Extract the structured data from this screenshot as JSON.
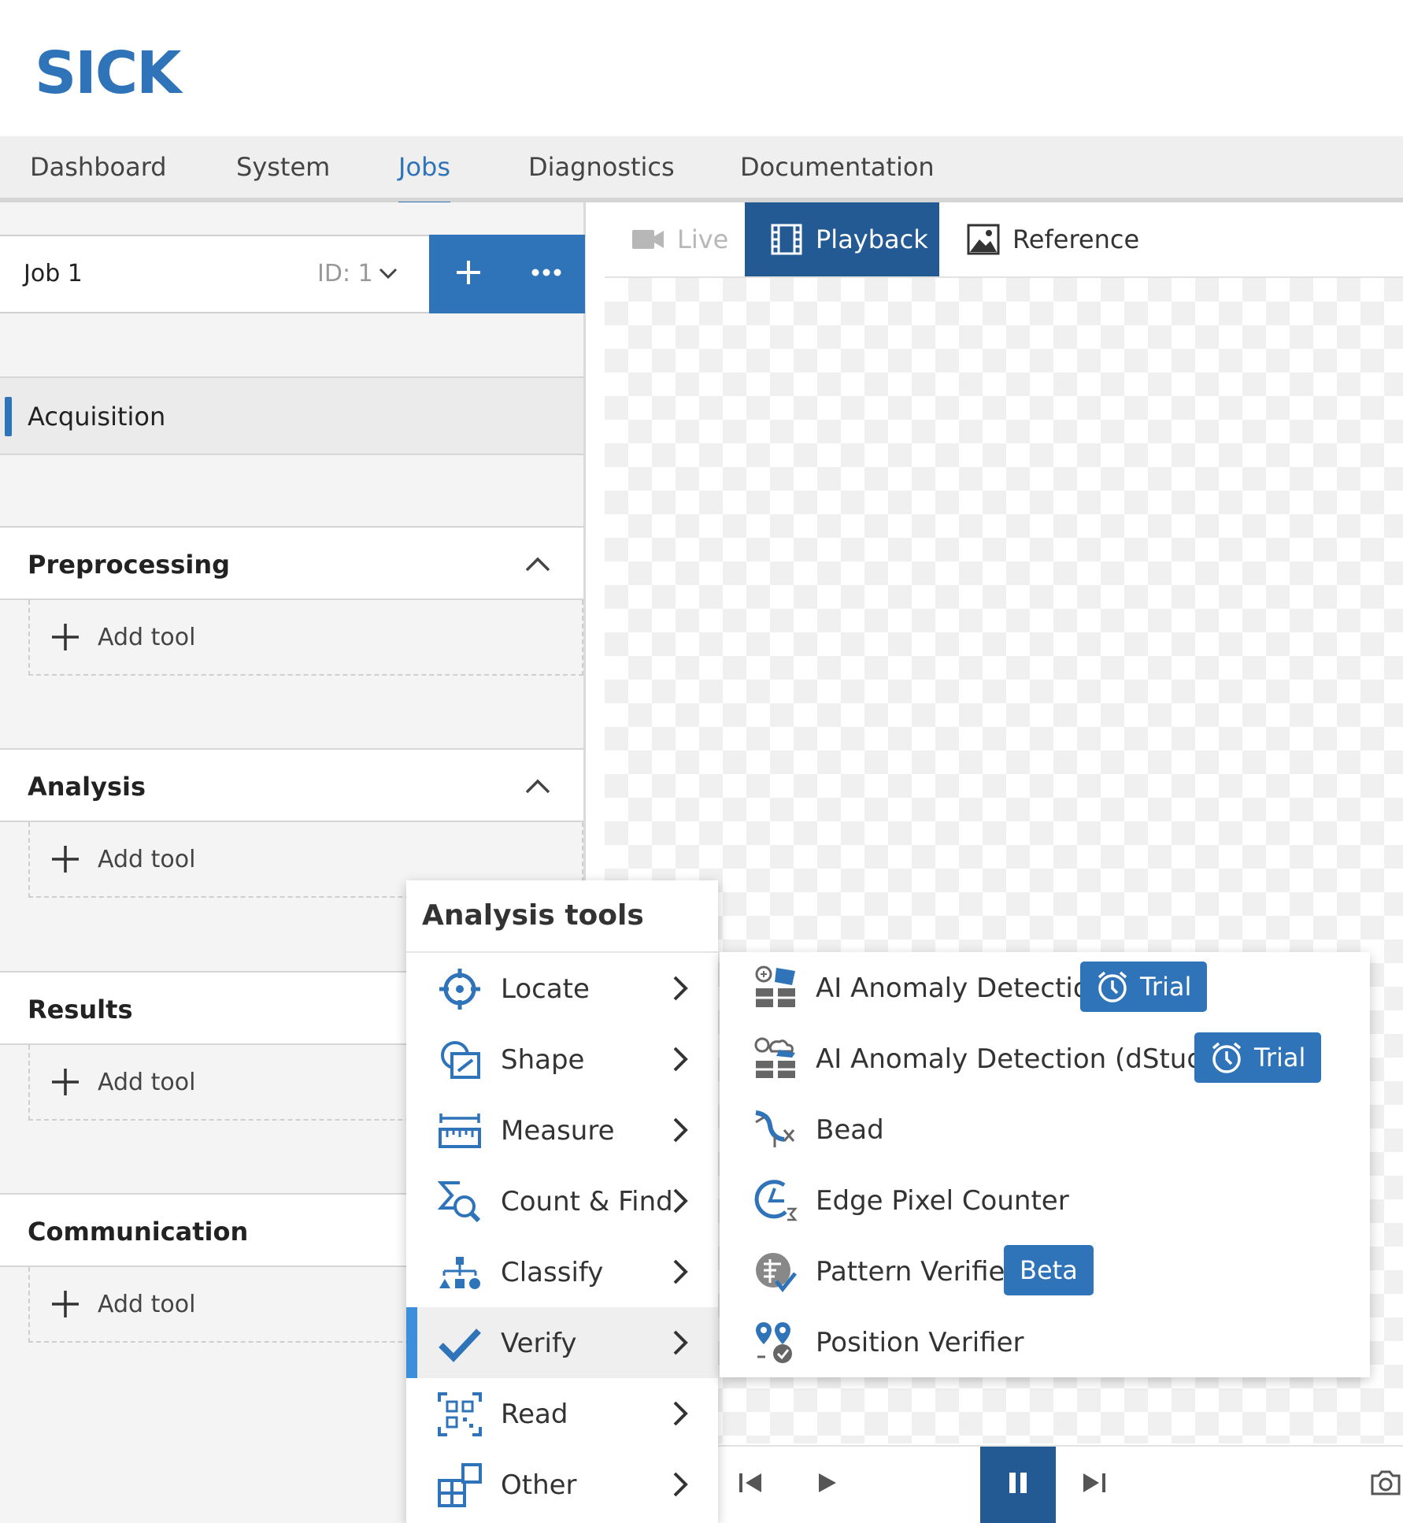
{
  "brand": {
    "logo_text": "SICK",
    "accent": "#2f73b8",
    "accent_dark": "#235a93",
    "highlight": "#3d8fdc"
  },
  "topnav": {
    "tabs": [
      {
        "label": "Dashboard"
      },
      {
        "label": "System"
      },
      {
        "label": "Jobs",
        "active": true
      },
      {
        "label": "Diagnostics"
      },
      {
        "label": "Documentation"
      }
    ]
  },
  "job": {
    "name": "Job 1",
    "id_label": "ID: 1"
  },
  "sidebar": {
    "acquisition": "Acquisition",
    "sections": [
      {
        "label": "Preprocessing",
        "add_label": "Add tool"
      },
      {
        "label": "Analysis",
        "add_label": "Add tool"
      },
      {
        "label": "Results",
        "add_label": "Add tool"
      },
      {
        "label": "Communication",
        "add_label": "Add tool"
      }
    ]
  },
  "viewer": {
    "tabs": [
      {
        "label": "Live",
        "icon": "video-camera-icon",
        "state": "disabled"
      },
      {
        "label": "Playback",
        "icon": "film-icon",
        "state": "active"
      },
      {
        "label": "Reference",
        "icon": "image-icon",
        "state": "normal"
      }
    ]
  },
  "analysis_menu": {
    "title": "Analysis tools",
    "items": [
      {
        "label": "Locate",
        "icon": "crosshair-icon"
      },
      {
        "label": "Shape",
        "icon": "shape-icon"
      },
      {
        "label": "Measure",
        "icon": "ruler-icon"
      },
      {
        "label": "Count & Find",
        "icon": "count-find-icon"
      },
      {
        "label": "Classify",
        "icon": "classify-icon"
      },
      {
        "label": "Verify",
        "icon": "checkmark-icon",
        "active": true
      },
      {
        "label": "Read",
        "icon": "qr-code-icon"
      },
      {
        "label": "Other",
        "icon": "other-tools-icon"
      }
    ]
  },
  "verify_submenu": {
    "items": [
      {
        "label": "AI Anomaly Detection",
        "badge": "Trial",
        "icon": "ai-anomaly-icon"
      },
      {
        "label": "AI Anomaly Detection (dStudio)",
        "badge": "Trial",
        "icon": "ai-anomaly-cloud-icon"
      },
      {
        "label": "Bead",
        "badge": "",
        "icon": "bead-icon"
      },
      {
        "label": "Edge Pixel Counter",
        "badge": "",
        "icon": "edge-pixel-counter-icon"
      },
      {
        "label": "Pattern Verifier",
        "badge": "Beta",
        "icon": "pattern-verifier-icon"
      },
      {
        "label": "Position Verifier",
        "badge": "",
        "icon": "position-verifier-icon"
      }
    ]
  }
}
